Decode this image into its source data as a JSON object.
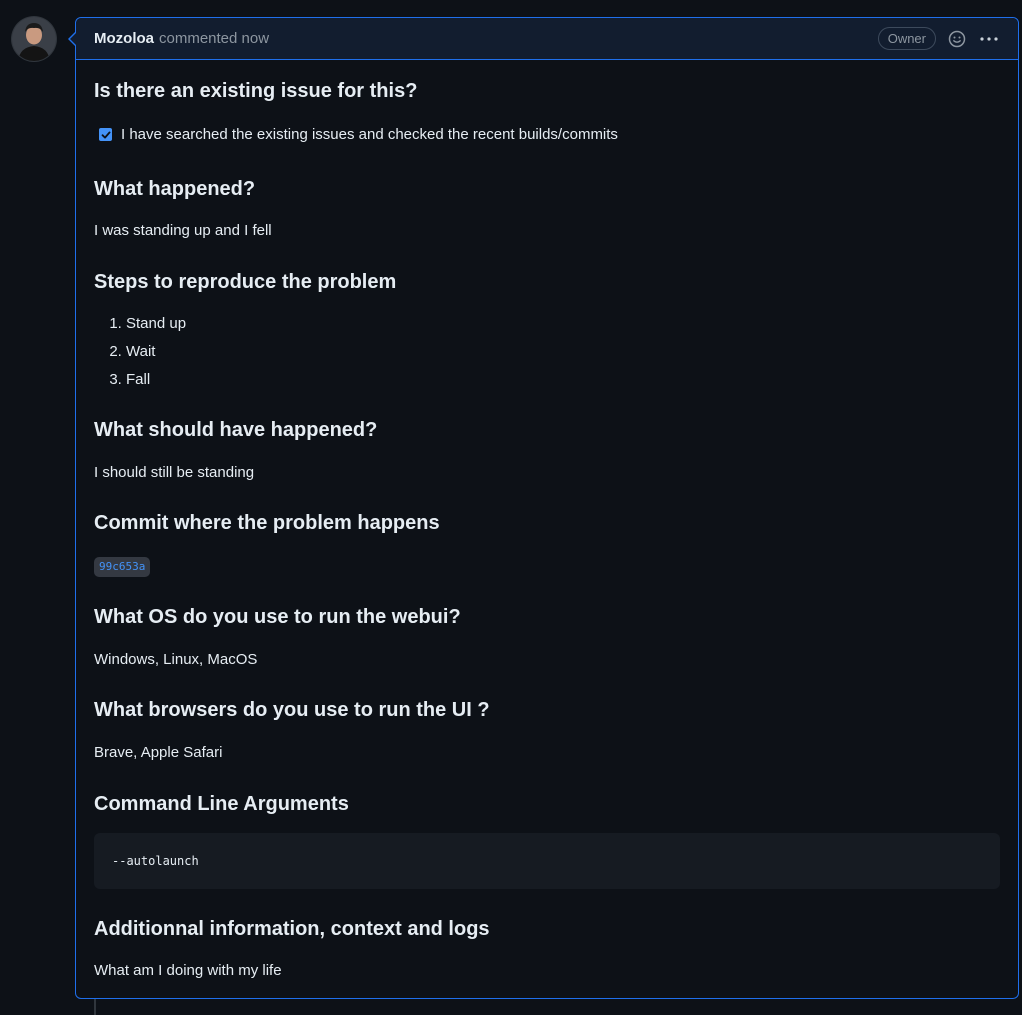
{
  "comment": {
    "author": "Mozoloa",
    "action": "commented now",
    "badge": "Owner",
    "icons": [
      "smiley-icon",
      "kebab-menu-icon"
    ]
  },
  "sections": {
    "existing_issue": {
      "heading": "Is there an existing issue for this?",
      "checkbox_label": "I have searched the existing issues and checked the recent builds/commits",
      "checked": true
    },
    "what_happened": {
      "heading": "What happened?",
      "text": "I was standing up and I fell"
    },
    "steps": {
      "heading": "Steps to reproduce the problem",
      "items": [
        "Stand up",
        "Wait",
        "Fall"
      ]
    },
    "expected": {
      "heading": "What should have happened?",
      "text": "I should still be standing"
    },
    "commit": {
      "heading": "Commit where the problem happens",
      "hash": "99c653a"
    },
    "os": {
      "heading": "What OS do you use to run the webui?",
      "text": "Windows, Linux, MacOS"
    },
    "browsers": {
      "heading": "What browsers do you use to run the UI ?",
      "text": "Brave, Apple Safari"
    },
    "cli_args": {
      "heading": "Command Line Arguments",
      "code": "--autolaunch"
    },
    "additional": {
      "heading": "Additionnal information, context and logs",
      "text": "What am I doing with my life"
    }
  },
  "colors": {
    "background": "#0d1117",
    "header_bg": "#121d2f",
    "border_accent": "#1f6feb",
    "link": "#4493f8",
    "muted": "#8d96a0"
  }
}
